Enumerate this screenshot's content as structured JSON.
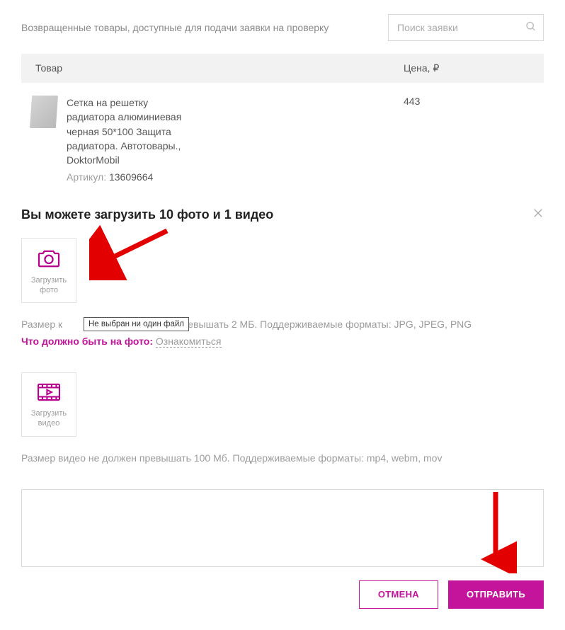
{
  "header": {
    "returned_goods_text": "Возвращенные товары, доступные для подачи заявки на проверку",
    "search_placeholder": "Поиск заявки"
  },
  "table": {
    "col_product": "Товар",
    "col_price": "Цена, ₽"
  },
  "product": {
    "name": "Сетка на решетку радиатора алюминиевая черная 50*100 Защита радиатора. Автотовары., DoktorMobil",
    "article_label": "Артикул:",
    "article_value": "13609664",
    "price": "443"
  },
  "upload": {
    "heading": "Вы можете загрузить 10 фото и 1 видео",
    "photo_label": "Загрузить фото",
    "photo_size_note_prefix": "Размер к",
    "photo_size_note_suffix": "превышать 2 МБ. Поддерживаемые форматы: JPG, JPEG, PNG",
    "tooltip_text": "Не выбран ни один файл",
    "photo_req_label": "Что должно быть на фото:",
    "photo_req_link": "Ознакомиться",
    "video_label": "Загрузить видео",
    "video_size_note": "Размер видео не должен превышать 100 Мб. Поддерживаемые форматы: mp4, webm, mov"
  },
  "buttons": {
    "cancel": "ОТМЕНА",
    "submit": "ОТПРАВИТЬ"
  },
  "colors": {
    "accent": "#c3149b",
    "annotation": "#e30000"
  }
}
